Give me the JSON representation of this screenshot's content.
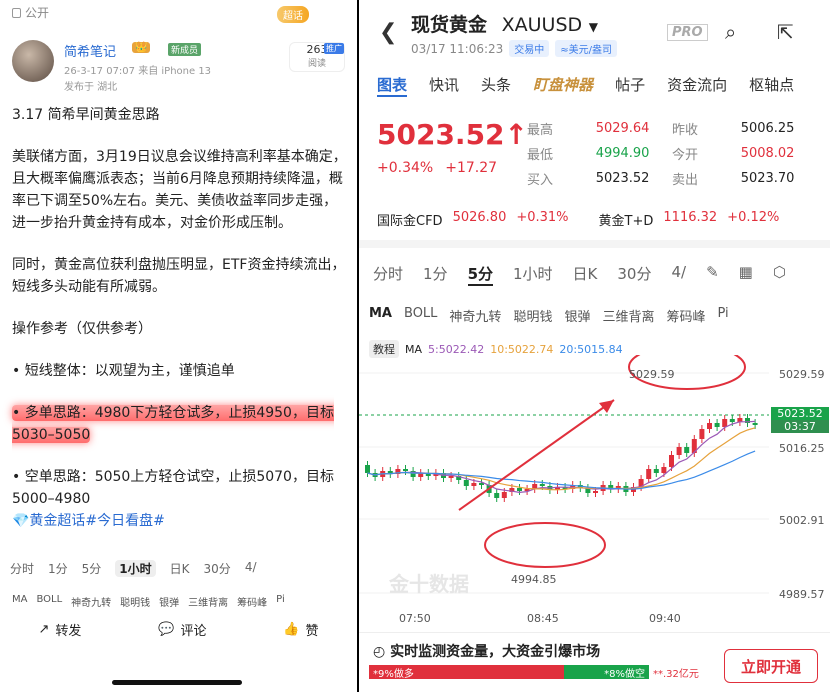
{
  "left": {
    "public_label": "公开",
    "super_badge": "超话",
    "author": {
      "name": "简希笔记",
      "vip": "👑",
      "tag": "新成员",
      "meta": "26-3-17 07:07 来自 iPhone 13",
      "location": "发布于 湖北"
    },
    "reads": {
      "count": "263",
      "label": "阅读",
      "promo": "推广"
    },
    "article": {
      "title": "3.17 简希早间黄金思路",
      "para1": "美联储方面，3月19日议息会议维持高利率基本确定，且大概率偏鹰派表态；当前6月降息预期持续降温，概率已下调至50%左右。美元、美债收益率同步走强，进一步抬升黄金持有成本，对金价形成压制。",
      "para2": "同时，黄金高位获利盘抛压明显，ETF资金持续流出，短线多头动能有所减弱。",
      "ops": "操作参考（仅供参考）",
      "short": "• 短线整体：以观望为主，谨慎追单",
      "long": "• 多单思路：4980下方轻仓试多，止损4950，目标5030–5050",
      "shortpos": "• 空单思路：5050上方轻仓试空，止损5070，目标5000–4980",
      "hashtag": "💎黄金超话#今日看盘#"
    },
    "mini_tabs": [
      "分时",
      "1分",
      "5分",
      "1小时",
      "日K",
      "30分",
      "4/"
    ],
    "mini_inds": [
      "MA",
      "BOLL",
      "神奇九转",
      "聪明钱",
      "银弹",
      "三维背离",
      "筹码峰",
      "Pi"
    ],
    "actions": {
      "share": "转发",
      "comment": "评论",
      "like": "赞"
    }
  },
  "right": {
    "title": "现货黄金",
    "symbol": "XAUUSD",
    "time": "03/17 11:06:23",
    "status": "交易中",
    "unit": "≈美元/盎司",
    "pro": "PRO",
    "tabs": [
      "图表",
      "快讯",
      "头条",
      "盯盘神器",
      "帖子",
      "资金流向",
      "枢轴点"
    ],
    "price": "5023.52↑",
    "change_pct": "+0.34%",
    "change_abs": "+17.27",
    "stats": [
      {
        "k": "最高",
        "v": "5029.64",
        "c": "red"
      },
      {
        "k": "昨收",
        "v": "5006.25",
        "c": "dark"
      },
      {
        "k": "最低",
        "v": "4994.90",
        "c": "green"
      },
      {
        "k": "今开",
        "v": "5008.02",
        "c": "red"
      },
      {
        "k": "买入",
        "v": "5023.52",
        "c": "dark"
      },
      {
        "k": "卖出",
        "v": "5023.70",
        "c": "dark"
      }
    ],
    "cfd": {
      "name": "国际金CFD",
      "value": "5026.80",
      "pct": "+0.31%",
      "name2": "黄金T+D",
      "value2": "1116.32",
      "pct2": "+0.12%"
    },
    "periods": [
      "分时",
      "1分",
      "5分",
      "1小时",
      "日K",
      "30分",
      "4/"
    ],
    "indicators": [
      "MA",
      "BOLL",
      "神奇九转",
      "聪明钱",
      "银弹",
      "三维背离",
      "筹码峰",
      "Pi"
    ],
    "ma_info": {
      "tag": "教程",
      "ma": "MA",
      "ma5": "5:5022.42",
      "ma10": "10:5022.74",
      "ma20": "20:5015.84"
    },
    "chart_data": {
      "type": "candlestick",
      "y_labels": [
        "5029.59",
        "5016.25",
        "5002.91",
        "4989.57"
      ],
      "x_labels": [
        "07:50",
        "08:45",
        "09:40"
      ],
      "current": "5023.52",
      "countdown": "03:37",
      "high_label": "5029.59",
      "low_label": "4994.85",
      "watermark": "金十数据"
    },
    "banner": {
      "text": "实时监测资金量，大资金引爆市场",
      "long": "*9%做多",
      "short": "*8%做空",
      "amount": "**.32亿元",
      "cta": "立即开通"
    }
  }
}
